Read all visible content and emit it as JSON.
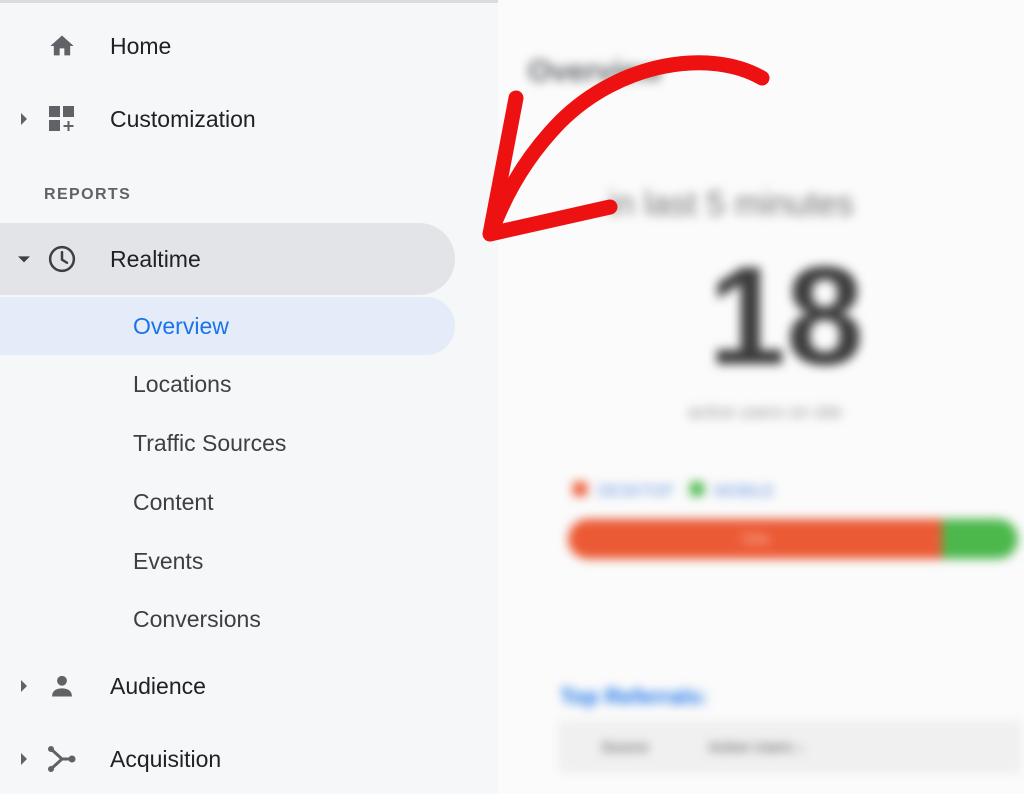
{
  "sidebar": {
    "items": [
      {
        "label": "Home",
        "icon": "home-icon",
        "expandable": false
      },
      {
        "label": "Customization",
        "icon": "dashboard-icon",
        "expandable": true
      }
    ],
    "section_label": "REPORTS",
    "realtime": {
      "label": "Realtime",
      "icon": "clock-icon",
      "expanded": true,
      "subitems": [
        {
          "label": "Overview",
          "active": true
        },
        {
          "label": "Locations",
          "active": false
        },
        {
          "label": "Traffic Sources",
          "active": false
        },
        {
          "label": "Content",
          "active": false
        },
        {
          "label": "Events",
          "active": false
        },
        {
          "label": "Conversions",
          "active": false
        }
      ]
    },
    "bottom_items": [
      {
        "label": "Audience",
        "icon": "person-icon",
        "expandable": true
      },
      {
        "label": "Acquisition",
        "icon": "acquisition-icon",
        "expandable": true
      }
    ]
  },
  "report": {
    "title": "Overview",
    "subtitle": "in last 5 minutes",
    "active_users": "18",
    "caption": "active users on site",
    "legend": [
      "DESKTOP",
      "MOBILE"
    ],
    "bar_label": "72%",
    "bar_split": {
      "desktop": 0.83,
      "mobile": 0.17
    },
    "section_link": "Top Referrals:",
    "table_headers": [
      "Source",
      "Active Users ↓"
    ]
  },
  "colors": {
    "sidebar_bg": "#f6f7f9",
    "active_bg": "#e4ebf9",
    "active_text": "#1a73e8",
    "desktop_bar": "#ec5a35",
    "mobile_bar": "#4cb84c",
    "annotation_arrow": "#ee1111"
  }
}
